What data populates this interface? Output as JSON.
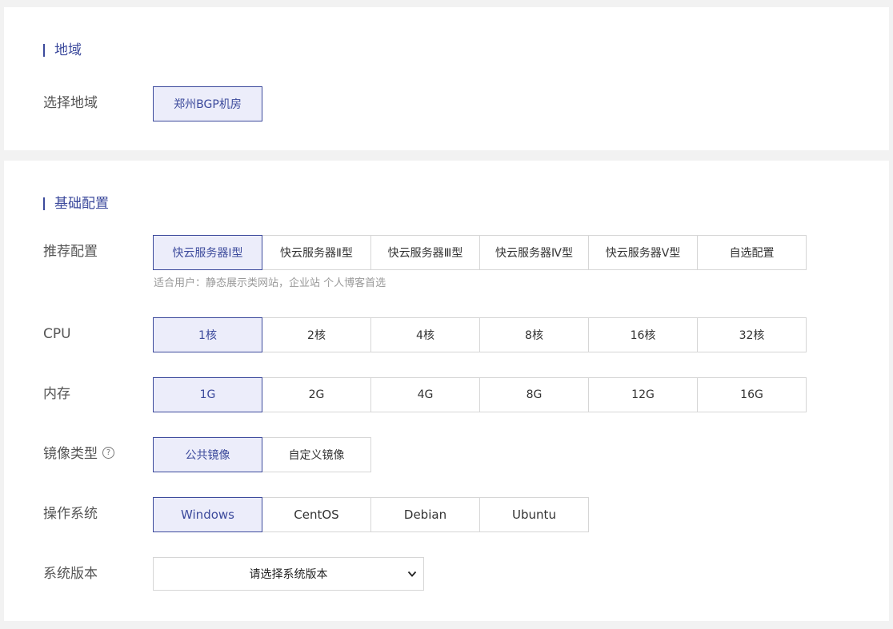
{
  "region_section": {
    "title": "地域",
    "label": "选择地域",
    "options": [
      "郑州BGP机房"
    ]
  },
  "config_section": {
    "title": "基础配置",
    "recommended": {
      "label": "推荐配置",
      "options": [
        "快云服务器Ⅰ型",
        "快云服务器Ⅱ型",
        "快云服务器Ⅲ型",
        "快云服务器Ⅳ型",
        "快云服务器Ⅴ型",
        "自选配置"
      ],
      "hint": "适合用户：静态展示类网站，企业站 个人博客首选"
    },
    "cpu": {
      "label": "CPU",
      "options": [
        "1核",
        "2核",
        "4核",
        "8核",
        "16核",
        "32核"
      ]
    },
    "memory": {
      "label": "内存",
      "options": [
        "1G",
        "2G",
        "4G",
        "8G",
        "12G",
        "16G"
      ]
    },
    "image_type": {
      "label": "镜像类型",
      "help_icon": "question-circle-icon",
      "help_glyph": "?",
      "options": [
        "公共镜像",
        "自定义镜像"
      ]
    },
    "os": {
      "label": "操作系统",
      "options": [
        "Windows",
        "CentOS",
        "Debian",
        "Ubuntu"
      ]
    },
    "os_version": {
      "label": "系统版本",
      "selected": "请选择系统版本",
      "icon": "chevron-down-icon"
    }
  },
  "colors": {
    "accent": "#3c4a9c",
    "selected_bg": "#ecedfa",
    "border": "#d6d6d6",
    "page_bg": "#f2f2f2"
  }
}
